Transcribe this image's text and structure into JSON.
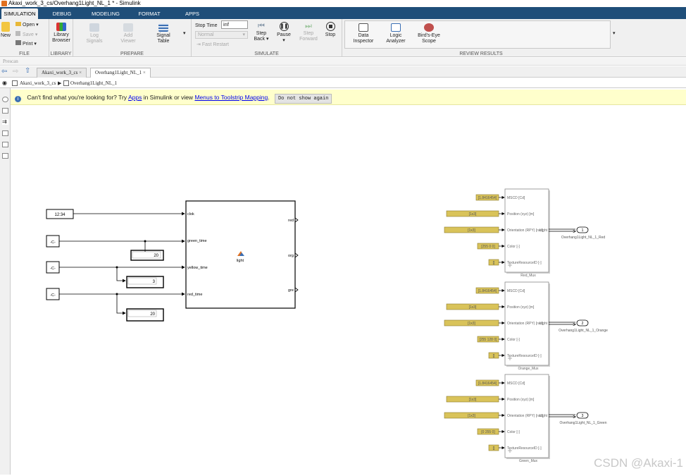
{
  "window": {
    "title": "Akaxi_work_3_cs/Overhang1Light_NL_1 * - Simulink"
  },
  "ribbon_tabs": [
    "SIMULATION",
    "DEBUG",
    "MODELING",
    "FORMAT",
    "APPS"
  ],
  "file_group": {
    "new": "New",
    "open": "Open",
    "save": "Save",
    "print": "Print",
    "label": "FILE"
  },
  "library_group": {
    "library_browser_1": "Library",
    "library_browser_2": "Browser",
    "label": "LIBRARY"
  },
  "prepare_group": {
    "log_1": "Log",
    "log_2": "Signals",
    "add_1": "Add",
    "add_2": "Viewer",
    "sig_1": "Signal",
    "sig_2": "Table",
    "label": "PREPARE"
  },
  "simulate_group": {
    "stop_time_label": "Stop Time",
    "stop_time_value": "inf",
    "mode": "Normal",
    "fast_restart": "Fast Restart",
    "step_back_1": "Step",
    "step_back_2": "Back",
    "pause": "Pause",
    "step_fwd_1": "Step",
    "step_fwd_2": "Forward",
    "stop": "Stop",
    "label": "SIMULATE"
  },
  "review_group": {
    "data_1": "Data",
    "data_2": "Inspector",
    "logic_1": "Logic",
    "logic_2": "Analyzer",
    "bird_1": "Bird's-Eye",
    "bird_2": "Scope",
    "label": "REVIEW RESULTS"
  },
  "prescan_label": "Prescan",
  "model_tabs": [
    "Akaxi_work_3_cs",
    "Overhang1Light_NL_1"
  ],
  "breadcrumb": {
    "root": "Akaxi_work_3_cs",
    "child": "Overhang1Light_NL_1"
  },
  "infobar": {
    "pre": "Can't find what you're looking for? Try ",
    "apps": "Apps",
    "mid": " in Simulink or view ",
    "menus": "Menus to Toolstrip Mapping",
    "post": ".",
    "dismiss": "Do not show again"
  },
  "diagram": {
    "clock": "12:34",
    "const": "-C-",
    "display_green": "20",
    "display_yellow": "3",
    "display_red": "20",
    "light_inputs": [
      "clok",
      "green_time",
      "yellow_time",
      "red_time"
    ],
    "light_outputs": [
      "red",
      "org",
      "gre"
    ],
    "light_name": "light",
    "mux_ports": [
      "MSCD [Cd]",
      "Position (xyz) [m]",
      "Orientation (RPY) [rad]",
      "Color [-]",
      "TextureResourceID [-]"
    ],
    "mux_out": "Light",
    "muxes": [
      {
        "name": "Red_Mux",
        "inputs": [
          "[1.8416454]",
          "[1x3]",
          "[1x3]",
          "[255 0 0]",
          "[]"
        ],
        "out_num": "1",
        "out_name": "Overhang1Light_NL_1_Red"
      },
      {
        "name": "Orange_Mux",
        "inputs": [
          "[1.8416454]",
          "[1x3]",
          "[1x3]",
          "[255 128 0]",
          "[]"
        ],
        "out_num": "2",
        "out_name": "Overhang1Light_NL_1_Orange"
      },
      {
        "name": "Green_Mux",
        "inputs": [
          "[1.8416454]",
          "[1x3]",
          "[1x3]",
          "[0 255 0]",
          "[]"
        ],
        "out_num": "3",
        "out_name": "Overhang1Light_NL_1_Green"
      }
    ]
  },
  "watermark": "CSDN @Akaxi-1"
}
